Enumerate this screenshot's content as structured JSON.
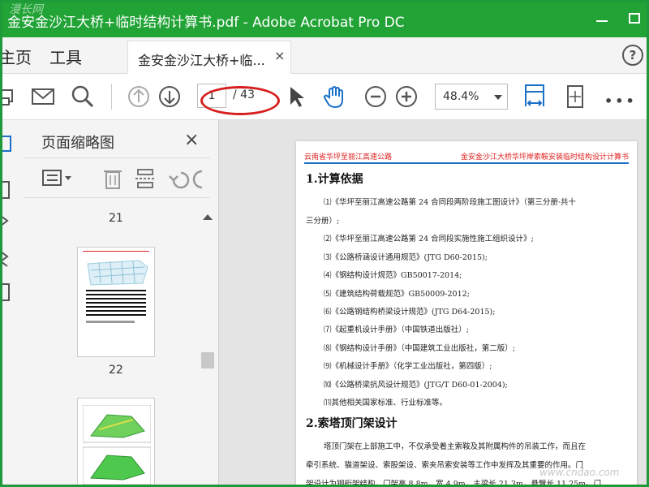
{
  "window": {
    "title": "金安金沙江大桥+临时结构计算书.pdf - Adobe Acrobat Pro DC",
    "accent": "#21a336"
  },
  "menu": {
    "home": "主页",
    "tools": "工具",
    "doc_tab": "金安金沙江大桥+临...",
    "close_glyph": "×",
    "help_glyph": "?"
  },
  "toolbar": {
    "page_current": "1",
    "page_total": "/ 43",
    "zoom": "48.4%",
    "more": "•••",
    "icons": [
      "print-icon",
      "mail-icon",
      "search-icon",
      "prev-page-icon",
      "next-page-icon",
      "select-icon",
      "hand-icon",
      "zoom-out-icon",
      "zoom-in-icon",
      "fit-width-icon",
      "rotate-page-icon",
      "more-icon"
    ]
  },
  "panel": {
    "title": "页面缩略图",
    "close_glyph": "×",
    "pages": [
      {
        "label": "21"
      },
      {
        "label": "22"
      }
    ]
  },
  "doc": {
    "header_left": "云南省华坪至丽江高速公路",
    "header_right": "金安金沙江大桥华坪岸索鞍安装临时结构设计计算书",
    "section1": "1.计算依据",
    "refs": [
      "⑴《华坪至丽江高速公路第 24 合同段两阶段施工图设计》（第三分册·共十",
      "三分册）;",
      "⑵《华坪至丽江高速公路第 24 合同段实施性施工组织设计》;",
      "⑶《公路桥涵设计通用规范》(JTG D60-2015);",
      "⑷《钢结构设计规范》GB50017-2014;",
      "⑸《建筑结构荷载规范》GB50009-2012;",
      "⑹《公路钢结构桥梁设计规范》(JTG D64-2015);",
      "⑺《起重机设计手册》（中国铁道出版社）;",
      "⑻《钢结构设计手册》（中国建筑工业出版社，第二版）;",
      "⑼《机械设计手册》（化学工业出版社，第四版）;",
      "⑽《公路桥梁抗风设计规范》(JTG/T  D60-01-2004);",
      "⑾其他相关国家标准、行业标准等。"
    ],
    "section2": "2.索塔顶门架设计",
    "paras": [
      "塔顶门架在上部施工中，不仅承受着主索鞍及其附属构件的吊装工作，而且在",
      "牵引系统、猫道架设、索股架设、索夹吊索安装等工作中发挥及其重要的作用。门",
      "架设计为钢桁架结构，门架高 8.8m，宽 4.9m，主梁长 21.3m，悬臂长 11.25m。门"
    ]
  },
  "watermark": {
    "top_left": "漫长网",
    "bottom_right": "www.cndao.com"
  }
}
